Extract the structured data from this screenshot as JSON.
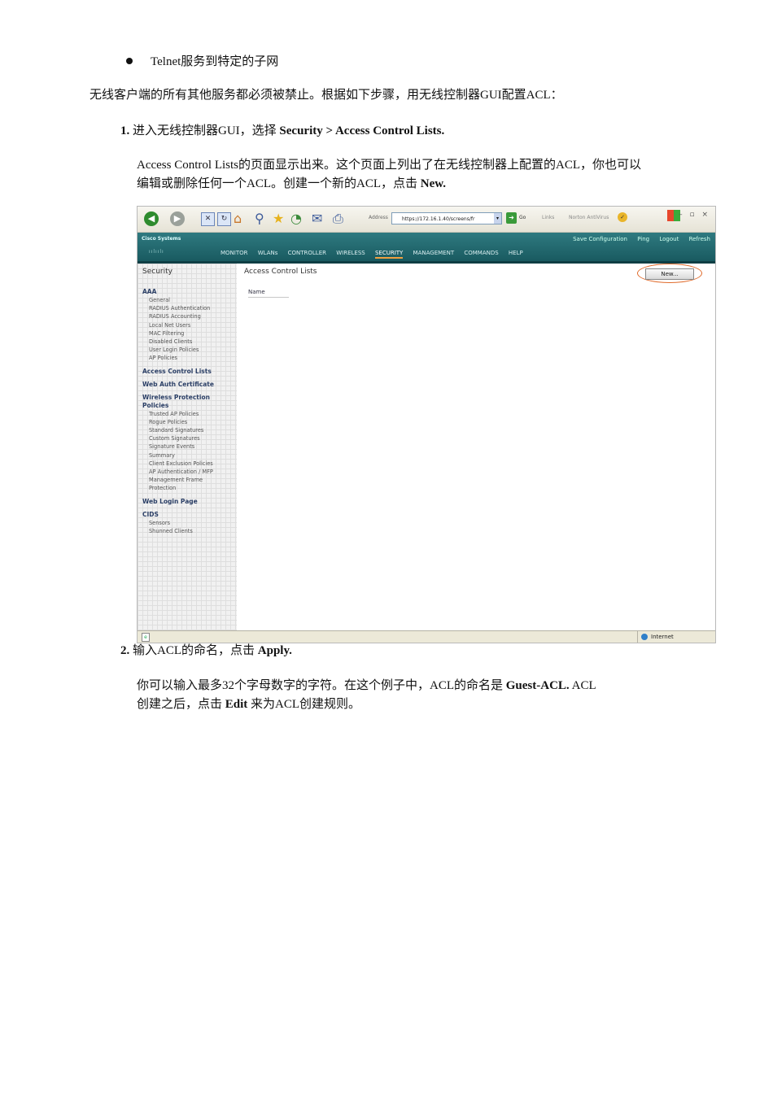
{
  "bullet": {
    "text": "Telnet服务到特定的子网"
  },
  "intro": {
    "text": "无线客户端的所有其他服务都必须被禁止。根据如下步骤，用无线控制器GUI配置ACL："
  },
  "step1": {
    "number": "1.",
    "text_before": "进入无线控制器GUI，选择 ",
    "bold": "Security > Access Control Lists.",
    "body_line1": "Access Control Lists的页面显示出来。这个页面上列出了在无线控制器上配置的ACL，你也可以",
    "body_line2_before": "编辑或删除任何一个ACL。创建一个新的ACL，点击 ",
    "body_line2_bold": "New."
  },
  "step2": {
    "number": "2.",
    "text_before": "输入ACL的命名，点击 ",
    "bold": "Apply.",
    "body_line1_before": "你可以输入最多32个字母数字的字符。在这个例子中，ACL的命名是 ",
    "body_line1_bold": "Guest-ACL.",
    "body_line1_after": " ACL",
    "body_line2_before": "创建之后，点击 ",
    "body_line2_bold": "Edit",
    "body_line2_after": " 来为ACL创建规则。"
  },
  "screenshot": {
    "toolbar": {
      "address_label": "Address",
      "address_value": "https://172.16.1.40/screens/fr",
      "go_label": "Go",
      "links_label": "Links",
      "norton_label": "Norton AntiVirus"
    },
    "header": {
      "logo": "Cisco Systems",
      "utility_links": [
        "Save Configuration",
        "Ping",
        "Logout",
        "Refresh"
      ],
      "menu": [
        "MONITOR",
        "WLANs",
        "CONTROLLER",
        "WIRELESS",
        "SECURITY",
        "MANAGEMENT",
        "COMMANDS",
        "HELP"
      ],
      "active_menu": "SECURITY"
    },
    "sidebar": {
      "title": "Security",
      "aaa": "AAA",
      "aaa_items": [
        "General",
        "RADIUS Authentication",
        "RADIUS Accounting",
        "Local Net Users",
        "MAC Filtering",
        "Disabled Clients",
        "User Login Policies",
        "AP Policies"
      ],
      "acl": "Access Control Lists",
      "webauth": "Web Auth Certificate",
      "wpp": "Wireless Protection Policies",
      "wpp_items": [
        "Trusted AP Policies",
        "Rogue Policies",
        "Standard Signatures",
        "Custom Signatures",
        "Signature Events Summary",
        "Client Exclusion Policies",
        "AP Authentication / MFP",
        "Management Frame Protection"
      ],
      "weblogin": "Web Login Page",
      "cids": "CIDS",
      "cids_items": [
        "Sensors",
        "Shunned Clients"
      ]
    },
    "main": {
      "title": "Access Control Lists",
      "new_button": "New...",
      "column_name": "Name"
    },
    "status": {
      "zone": "Internet"
    }
  }
}
